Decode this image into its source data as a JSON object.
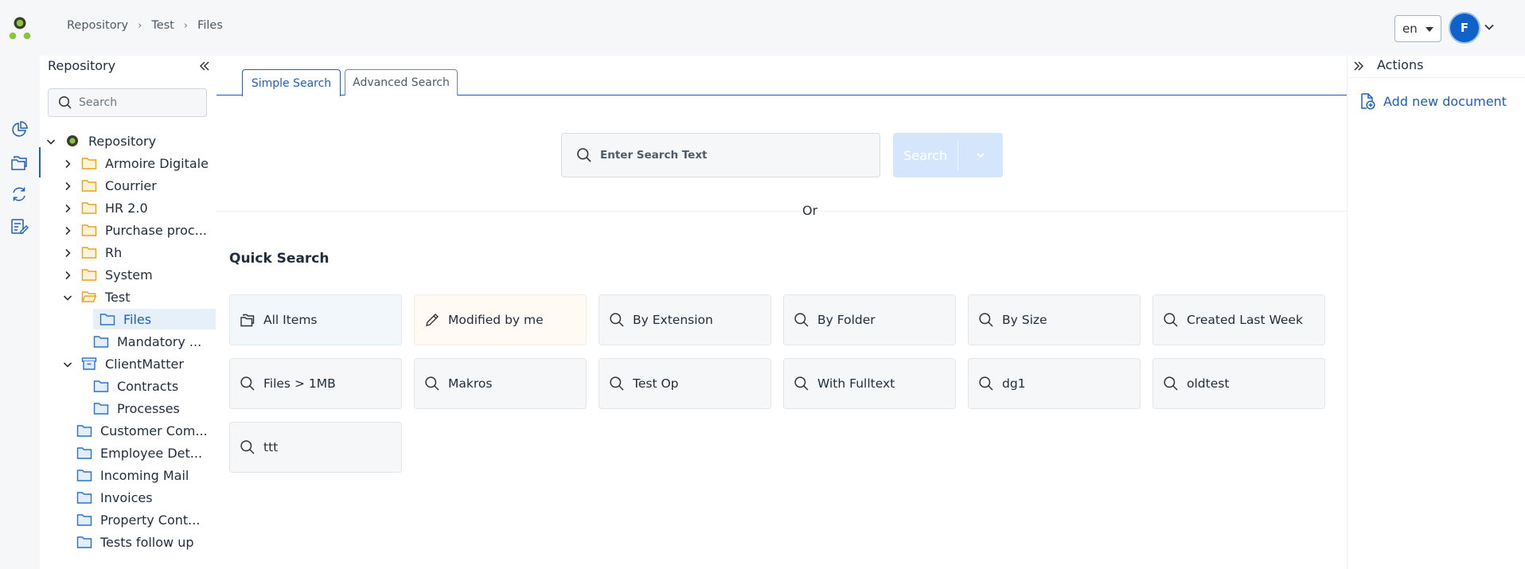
{
  "header": {
    "breadcrumb": [
      "Repository",
      "Test",
      "Files"
    ],
    "language": "en",
    "avatar_initial": "F"
  },
  "tree": {
    "title": "Repository",
    "search_placeholder": "Search",
    "items": [
      {
        "label": "Repository",
        "icon": "repository-logo-icon",
        "state": "expanded"
      },
      {
        "label": "Armoire Digitale",
        "icon": "folder-icon",
        "state": "collapsed"
      },
      {
        "label": "Courrier",
        "icon": "folder-icon",
        "state": "collapsed"
      },
      {
        "label": "HR 2.0",
        "icon": "folder-icon",
        "state": "collapsed"
      },
      {
        "label": "Purchase proc...",
        "icon": "folder-icon",
        "state": "collapsed"
      },
      {
        "label": "Rh",
        "icon": "folder-icon",
        "state": "collapsed"
      },
      {
        "label": "System",
        "icon": "folder-icon",
        "state": "collapsed"
      },
      {
        "label": "Test",
        "icon": "folder-open-icon",
        "state": "expanded"
      },
      {
        "label": "Files",
        "icon": "blue-folder-icon",
        "state": "selected"
      },
      {
        "label": "Mandatory ...",
        "icon": "blue-folder-icon",
        "state": "leaf"
      },
      {
        "label": "ClientMatter",
        "icon": "archive-box-icon",
        "state": "expanded"
      },
      {
        "label": "Contracts",
        "icon": "blue-folder-icon",
        "state": "leaf"
      },
      {
        "label": "Processes",
        "icon": "blue-folder-icon",
        "state": "leaf"
      },
      {
        "label": "Customer Com...",
        "icon": "blue-folder-icon",
        "state": "leaf"
      },
      {
        "label": "Employee Det...",
        "icon": "blue-folder-icon",
        "state": "leaf"
      },
      {
        "label": "Incoming Mail",
        "icon": "blue-folder-icon",
        "state": "leaf"
      },
      {
        "label": "Invoices",
        "icon": "blue-folder-icon",
        "state": "leaf"
      },
      {
        "label": "Property Cont...",
        "icon": "blue-folder-icon",
        "state": "leaf"
      },
      {
        "label": "Tests follow up",
        "icon": "blue-folder-icon",
        "state": "leaf"
      }
    ]
  },
  "tabs": {
    "simple": "Simple Search",
    "advanced": "Advanced Search"
  },
  "search": {
    "placeholder": "Enter Search Text",
    "button": "Search",
    "or": "Or"
  },
  "quick_search": {
    "title": "Quick Search",
    "items": [
      {
        "label": "All Items",
        "icon": "folders-icon"
      },
      {
        "label": "Modified by me",
        "icon": "pencil-icon"
      },
      {
        "label": "By Extension",
        "icon": "search-icon"
      },
      {
        "label": "By Folder",
        "icon": "search-icon"
      },
      {
        "label": "By Size",
        "icon": "search-icon"
      },
      {
        "label": "Created Last Week",
        "icon": "search-icon"
      },
      {
        "label": "Files > 1MB",
        "icon": "search-icon"
      },
      {
        "label": "Makros",
        "icon": "search-icon"
      },
      {
        "label": "Test Op",
        "icon": "search-icon"
      },
      {
        "label": "With Fulltext",
        "icon": "search-icon"
      },
      {
        "label": "dg1",
        "icon": "search-icon"
      },
      {
        "label": "oldtest",
        "icon": "search-icon"
      },
      {
        "label": "ttt",
        "icon": "search-icon"
      }
    ]
  },
  "actions": {
    "title": "Actions",
    "add_document": "Add new document"
  },
  "colors": {
    "accent": "#1f5fb5",
    "folder_yellow": "#e8a21c",
    "folder_blue": "#2a72c9",
    "logo_green": "#7ab51d"
  }
}
